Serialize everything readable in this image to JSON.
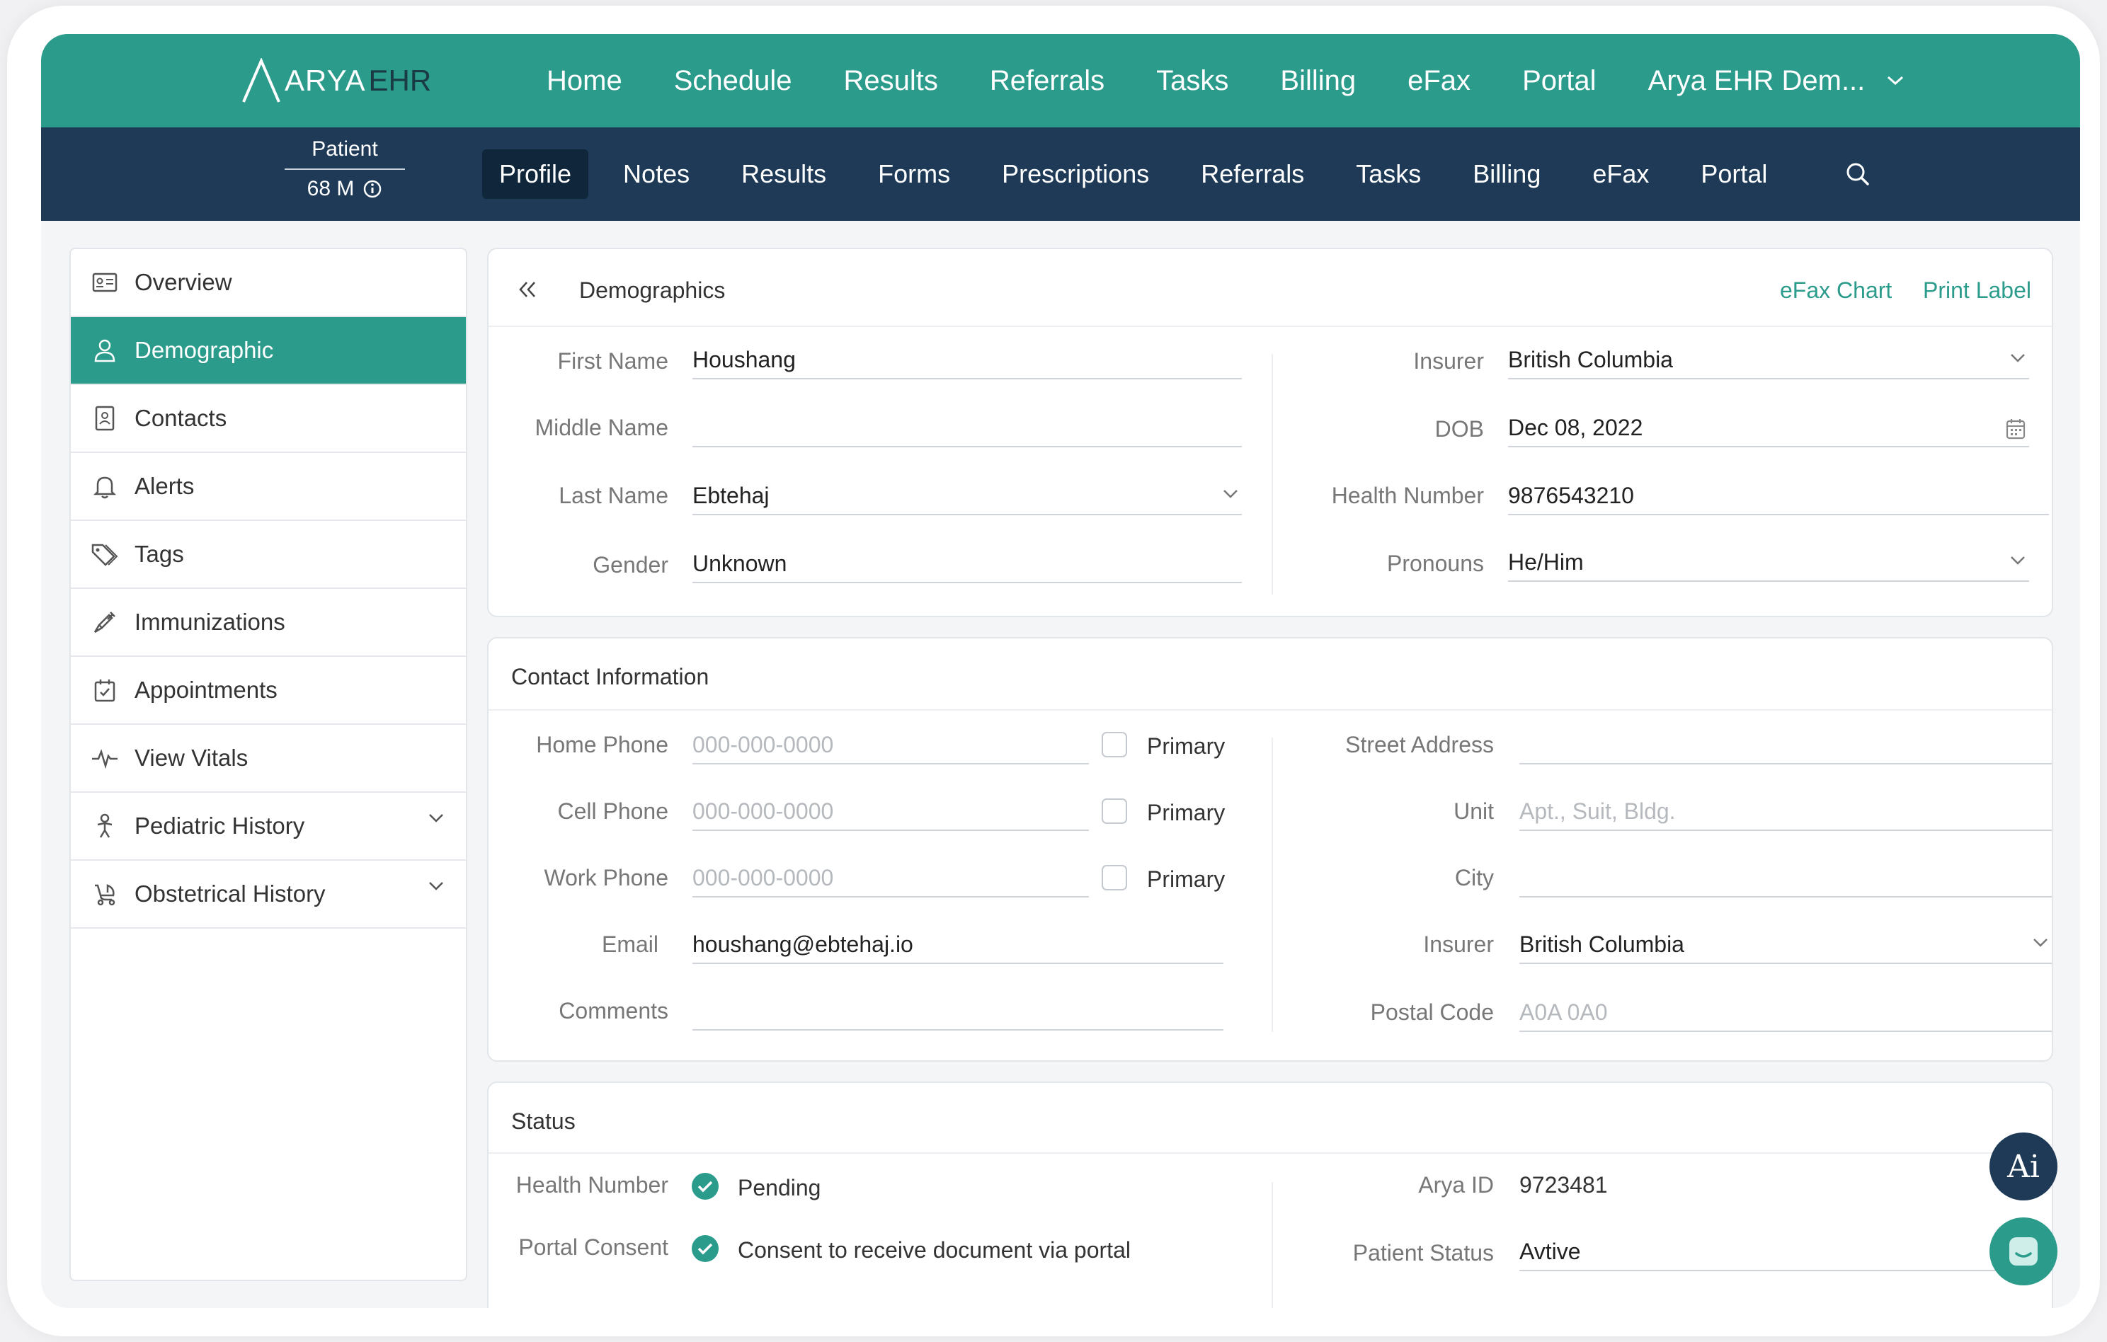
{
  "brand": {
    "logo_main": "ARYA",
    "logo_suffix": "EHR"
  },
  "topnav": {
    "items": [
      "Home",
      "Schedule",
      "Results",
      "Referrals",
      "Tasks",
      "Billing",
      "eFax",
      "Portal"
    ],
    "user": "Arya EHR Dem..."
  },
  "patient": {
    "label": "Patient",
    "age_sex": "68  M"
  },
  "subnav": {
    "items": [
      "Profile",
      "Notes",
      "Results",
      "Forms",
      "Prescriptions",
      "Referrals",
      "Tasks",
      "Billing",
      "eFax",
      "Portal"
    ],
    "active": "Profile"
  },
  "sidebar": {
    "items": [
      {
        "label": "Overview",
        "icon": "id-card-icon"
      },
      {
        "label": "Demographic",
        "icon": "user-icon"
      },
      {
        "label": "Contacts",
        "icon": "contact-book-icon"
      },
      {
        "label": "Alerts",
        "icon": "bell-icon"
      },
      {
        "label": "Tags",
        "icon": "tag-icon"
      },
      {
        "label": "Immunizations",
        "icon": "syringe-icon"
      },
      {
        "label": "Appointments",
        "icon": "calendar-check-icon"
      },
      {
        "label": "View Vitals",
        "icon": "pulse-icon"
      },
      {
        "label": "Pediatric History",
        "icon": "baby-icon"
      },
      {
        "label": "Obstetrical History",
        "icon": "stroller-icon"
      }
    ]
  },
  "demographics": {
    "title": "Demographics",
    "efax_chart": "eFax Chart",
    "print_label": "Print Label",
    "first_name": {
      "label": "First Name",
      "value": "Houshang"
    },
    "middle_name": {
      "label": "Middle Name",
      "value": ""
    },
    "last_name": {
      "label": "Last Name",
      "value": "Ebtehaj"
    },
    "gender": {
      "label": "Gender",
      "value": "Unknown"
    },
    "insurer": {
      "label": "Insurer",
      "value": "British Columbia"
    },
    "dob": {
      "label": "DOB",
      "value": "Dec 08, 2022"
    },
    "health_number": {
      "label": "Health Number",
      "value": "9876543210"
    },
    "pronouns": {
      "label": "Pronouns",
      "value": "He/Him"
    }
  },
  "contact": {
    "title": "Contact Information",
    "home_phone": {
      "label": "Home Phone",
      "placeholder": "000-000-0000",
      "primary": "Primary"
    },
    "cell_phone": {
      "label": "Cell Phone",
      "placeholder": "000-000-0000",
      "primary": "Primary"
    },
    "work_phone": {
      "label": "Work Phone",
      "placeholder": "000-000-0000",
      "primary": "Primary"
    },
    "email": {
      "label": "Email",
      "value": "houshang@ebtehaj.io"
    },
    "comments": {
      "label": "Comments",
      "value": ""
    },
    "street": {
      "label": "Street Address",
      "value": ""
    },
    "unit": {
      "label": "Unit",
      "placeholder": "Apt., Suit, Bldg."
    },
    "city": {
      "label": "City",
      "value": ""
    },
    "insurer": {
      "label": "Insurer",
      "value": "British Columbia"
    },
    "postal": {
      "label": "Postal Code",
      "placeholder": "A0A 0A0"
    }
  },
  "status": {
    "title": "Status",
    "health_number": {
      "label": "Health Number",
      "value": "Pending"
    },
    "portal_consent": {
      "label": "Portal Consent",
      "value": "Consent to receive document via portal"
    },
    "arya_id": {
      "label": "Arya ID",
      "value": "9723481"
    },
    "patient_status": {
      "label": "Patient Status",
      "value": "Avtive"
    }
  },
  "floating": {
    "ai_label": "Ai"
  },
  "colors": {
    "teal": "#2b9b8b",
    "navy": "#1e3a56",
    "navy_dark": "#10263b"
  }
}
